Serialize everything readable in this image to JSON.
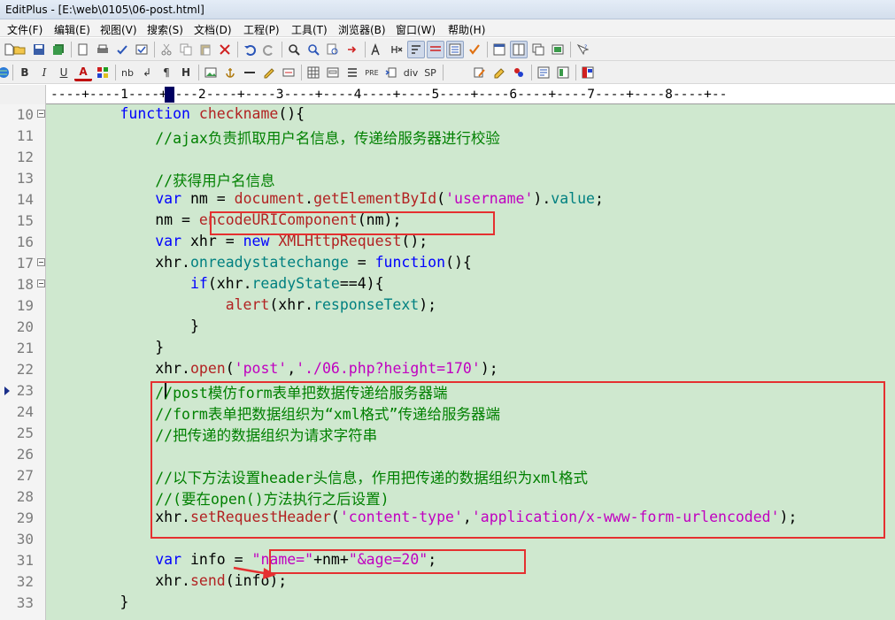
{
  "window": {
    "title": "EditPlus - [E:\\web\\0105\\06-post.html]"
  },
  "menu": [
    {
      "label": "文件(F)"
    },
    {
      "label": "编辑(E)"
    },
    {
      "label": "视图(V)"
    },
    {
      "label": "搜索(S)"
    },
    {
      "label": "文档(D)"
    },
    {
      "label": "工程(P)"
    },
    {
      "label": "工具(T)"
    },
    {
      "label": "浏览器(B)"
    },
    {
      "label": "窗口(W)"
    },
    {
      "label": "帮助(H)"
    }
  ],
  "toolbar2": {
    "bold": "B",
    "italic": "I",
    "underline": "U",
    "font_color": "A",
    "nbsp": "nb",
    "br": "↲",
    "para": "¶",
    "heading": "H",
    "pre": "PRE",
    "div": "div",
    "span": "SP"
  },
  "ruler": {
    "text": "----+----1----+----2----+----3----+----4----+----5----+----6----+----7----+----8----+--"
  },
  "editor": {
    "lines": [
      {
        "n": "10",
        "fold": true,
        "parts": [
          [
            "",
            "        "
          ],
          [
            "kw",
            "function"
          ],
          [
            "",
            " "
          ],
          [
            "fn",
            "checkname"
          ],
          [
            "",
            "(){"
          ]
        ]
      },
      {
        "n": "11",
        "fold": false,
        "parts": [
          [
            "",
            "            "
          ],
          [
            "cm",
            "//ajax负责抓取用户名信息，传递给服务器进行校验"
          ]
        ]
      },
      {
        "n": "12",
        "fold": false,
        "parts": [
          [
            "",
            ""
          ]
        ]
      },
      {
        "n": "13",
        "fold": false,
        "parts": [
          [
            "",
            "            "
          ],
          [
            "cm",
            "//获得用户名信息"
          ]
        ]
      },
      {
        "n": "14",
        "fold": false,
        "parts": [
          [
            "",
            "            "
          ],
          [
            "kw",
            "var"
          ],
          [
            "",
            " nm = "
          ],
          [
            "fn",
            "document"
          ],
          [
            "",
            "."
          ],
          [
            "fn",
            "getElementById"
          ],
          [
            "",
            "("
          ],
          [
            "str",
            "'username'"
          ],
          [
            "",
            ")."
          ],
          [
            "attr",
            "value"
          ],
          [
            "",
            ";"
          ]
        ]
      },
      {
        "n": "15",
        "fold": false,
        "parts": [
          [
            "",
            "            nm = "
          ],
          [
            "fn",
            "encodeURIComponent"
          ],
          [
            "",
            "(nm);"
          ]
        ]
      },
      {
        "n": "16",
        "fold": false,
        "parts": [
          [
            "",
            "            "
          ],
          [
            "kw",
            "var"
          ],
          [
            "",
            " xhr = "
          ],
          [
            "kw",
            "new"
          ],
          [
            "",
            " "
          ],
          [
            "fn",
            "XMLHttpRequest"
          ],
          [
            "",
            "();"
          ]
        ]
      },
      {
        "n": "17",
        "fold": true,
        "parts": [
          [
            "",
            "            xhr."
          ],
          [
            "attr",
            "onreadystatechange"
          ],
          [
            "",
            " = "
          ],
          [
            "kw",
            "function"
          ],
          [
            "",
            "(){"
          ]
        ]
      },
      {
        "n": "18",
        "fold": true,
        "parts": [
          [
            "",
            "                "
          ],
          [
            "kw",
            "if"
          ],
          [
            "",
            "(xhr."
          ],
          [
            "attr",
            "readyState"
          ],
          [
            "",
            "==4){"
          ]
        ]
      },
      {
        "n": "19",
        "fold": false,
        "parts": [
          [
            "",
            "                    "
          ],
          [
            "fn",
            "alert"
          ],
          [
            "",
            "(xhr."
          ],
          [
            "attr",
            "responseText"
          ],
          [
            "",
            ");"
          ]
        ]
      },
      {
        "n": "20",
        "fold": false,
        "parts": [
          [
            "",
            "                }"
          ]
        ]
      },
      {
        "n": "21",
        "fold": false,
        "parts": [
          [
            "",
            "            }"
          ]
        ]
      },
      {
        "n": "22",
        "fold": false,
        "parts": [
          [
            "",
            "            xhr."
          ],
          [
            "fn",
            "open"
          ],
          [
            "",
            "("
          ],
          [
            "str",
            "'post'"
          ],
          [
            "",
            ","
          ],
          [
            "str",
            "'./06.php?height=170'"
          ],
          [
            "",
            ");"
          ]
        ]
      },
      {
        "n": "23",
        "fold": false,
        "parts": [
          [
            "",
            "            "
          ],
          [
            "cm",
            "//post模仿form表单把数据传递给服务器端"
          ]
        ]
      },
      {
        "n": "24",
        "fold": false,
        "parts": [
          [
            "",
            "            "
          ],
          [
            "cm",
            "//form表单把数据组织为“xml格式”传递给服务器端"
          ]
        ]
      },
      {
        "n": "25",
        "fold": false,
        "parts": [
          [
            "",
            "            "
          ],
          [
            "cm",
            "//把传递的数据组织为请求字符串"
          ]
        ]
      },
      {
        "n": "26",
        "fold": false,
        "parts": [
          [
            "",
            ""
          ]
        ]
      },
      {
        "n": "27",
        "fold": false,
        "parts": [
          [
            "",
            "            "
          ],
          [
            "cm",
            "//以下方法设置header头信息，作用把传递的数据组织为xml格式"
          ]
        ]
      },
      {
        "n": "28",
        "fold": false,
        "parts": [
          [
            "",
            "            "
          ],
          [
            "cm",
            "//(要在open()方法执行之后设置)"
          ]
        ]
      },
      {
        "n": "29",
        "fold": false,
        "parts": [
          [
            "",
            "            xhr."
          ],
          [
            "fn",
            "setRequestHeader"
          ],
          [
            "",
            "("
          ],
          [
            "str",
            "'content-type'"
          ],
          [
            "",
            ","
          ],
          [
            "str",
            "'application/x-www-form-urlencoded'"
          ],
          [
            "",
            ");"
          ]
        ]
      },
      {
        "n": "30",
        "fold": false,
        "parts": [
          [
            "",
            ""
          ]
        ]
      },
      {
        "n": "31",
        "fold": false,
        "parts": [
          [
            "",
            "            "
          ],
          [
            "kw",
            "var"
          ],
          [
            "",
            " info = "
          ],
          [
            "str",
            "\"name=\""
          ],
          [
            "",
            "+nm+"
          ],
          [
            "str",
            "\"&age=20\""
          ],
          [
            "",
            ";"
          ]
        ]
      },
      {
        "n": "32",
        "fold": false,
        "parts": [
          [
            "",
            "            xhr."
          ],
          [
            "fn",
            "send"
          ],
          [
            "",
            "(info);"
          ]
        ]
      },
      {
        "n": "33",
        "fold": false,
        "parts": [
          [
            "",
            "        }"
          ]
        ]
      }
    ]
  },
  "colors": {
    "keyword": "#0000ff",
    "function": "#b22222",
    "string": "#c000c0",
    "comment": "#008000",
    "attribute": "#008080",
    "editor_bg": "#cfe8cf",
    "highlight": "#e53030"
  }
}
